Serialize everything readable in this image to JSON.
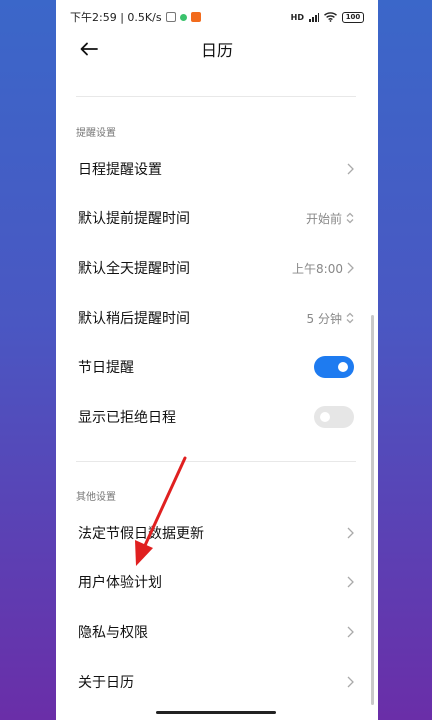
{
  "status_bar": {
    "time_speed": "下午2:59 | 0.5K/s",
    "signal": "HD",
    "battery": "100"
  },
  "header": {
    "title": "日历"
  },
  "sections": {
    "reminder": {
      "label": "提醒设置"
    },
    "other": {
      "label": "其他设置"
    }
  },
  "rows": {
    "schedule_reminder": {
      "label": "日程提醒设置"
    },
    "default_advance": {
      "label": "默认提前提醒时间",
      "value": "开始前"
    },
    "default_allday": {
      "label": "默认全天提醒时间",
      "value": "上午8:00"
    },
    "default_snooze": {
      "label": "默认稍后提醒时间",
      "value": "5 分钟"
    },
    "holiday_reminder": {
      "label": "节日提醒",
      "toggle": "on"
    },
    "show_declined": {
      "label": "显示已拒绝日程",
      "toggle": "off"
    },
    "holiday_update": {
      "label": "法定节假日数据更新"
    },
    "ux_plan": {
      "label": "用户体验计划"
    },
    "privacy": {
      "label": "隐私与权限"
    },
    "about": {
      "label": "关于日历"
    }
  },
  "colors": {
    "toggle_on": "#1e7bf0",
    "annotation_arrow": "#e02020"
  }
}
